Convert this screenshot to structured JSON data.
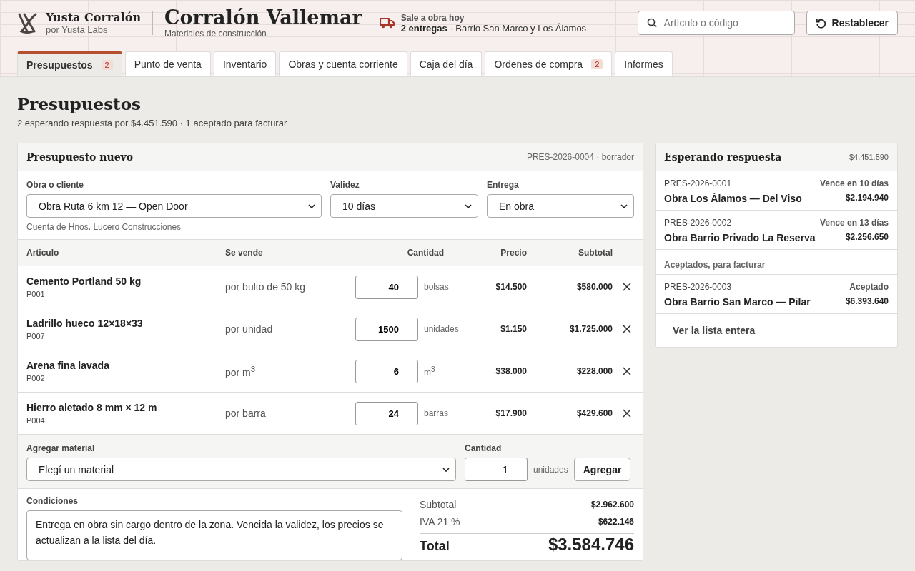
{
  "brand": {
    "name": "Yusta Corralón",
    "byline": "por Yusta Labs"
  },
  "store": {
    "name": "Corralón Vallemar",
    "subtitle": "Materiales de construcción"
  },
  "deliveries": {
    "label": "Sale a obra hoy",
    "count": "2 entregas",
    "places": "· Barrio San Marco y Los Álamos"
  },
  "search": {
    "placeholder": "Artículo o código"
  },
  "reset_button": "Restablecer",
  "tabs": [
    {
      "label": "Presupuestos",
      "badge": "2",
      "selected": true
    },
    {
      "label": "Punto de venta",
      "selected": false
    },
    {
      "label": "Inventario",
      "selected": false
    },
    {
      "label": "Obras y cuenta corriente",
      "selected": false
    },
    {
      "label": "Caja del día",
      "selected": false
    },
    {
      "label": "Órdenes de compra",
      "badge": "2",
      "selected": false
    },
    {
      "label": "Informes",
      "selected": false
    }
  ],
  "page": {
    "title": "Presupuestos",
    "summary": "2 esperando respuesta por $4.451.590 · 1 aceptado para facturar"
  },
  "quote": {
    "title": "Presupuesto nuevo",
    "code": "PRES-2026-0004 · borrador",
    "fields": [
      {
        "label": "Obra o cliente",
        "value": "Obra Ruta 6 km 12 — Open Door",
        "hint": "Cuenta de Hnos. Lucero Construcciones"
      },
      {
        "label": "Validez",
        "value": "10 días"
      },
      {
        "label": "Entrega",
        "value": "En obra"
      }
    ],
    "columns": [
      "Articulo",
      "Se vende",
      "Cantidad",
      "Precio",
      "Subtotal"
    ],
    "rows": [
      {
        "name": "Cemento Portland 50 kg",
        "code": "P001",
        "sold_by": "por bulto de 50 kg",
        "quantity": "40",
        "unit": "bolsas",
        "price": "$14.500",
        "subtotal": "$580.000"
      },
      {
        "name": "Ladrillo hueco 12×18×33",
        "code": "P007",
        "sold_by": "por unidad",
        "quantity": "1500",
        "unit": "unidades",
        "price": "$1.150",
        "subtotal": "$1.725.000"
      },
      {
        "name": "Arena fina lavada",
        "code": "P002",
        "sold_by": "por m$^{3}$",
        "quantity": "6",
        "unit": "m$^{3}$",
        "price": "$38.000",
        "subtotal": "$228.000"
      },
      {
        "name": "Hierro aletado 8 mm × 12 m",
        "code": "P004",
        "sold_by": "por barra",
        "quantity": "24",
        "unit": "barras",
        "price": "$17.900",
        "subtotal": "$429.600"
      }
    ],
    "add": {
      "material_label": "Agregar material",
      "material_value": "Elegí un material",
      "quantity_label": "Cantidad",
      "quantity": "1",
      "unit": "unidades",
      "button": "Agregar"
    },
    "conditions": {
      "label": "Condiciones",
      "text": "Entrega en obra sin cargo dentro de la zona. Vencida la validez, los precios se actualizan a la lista del día."
    },
    "totals": [
      {
        "label": "Subtotal",
        "value": "$2.962.600"
      },
      {
        "label": "IVA 21 %",
        "value": "$622.146"
      }
    ],
    "total": {
      "label": "Total",
      "value": "$3.584.746"
    }
  },
  "waiting": {
    "title": "Esperando respuesta",
    "amount": "$4.451.590",
    "items": [
      {
        "code": "PRES-2026-0001",
        "status": "Vence en 10 días",
        "name": "Obra Los Álamos — Del Viso",
        "amount": "$2.194.940"
      },
      {
        "code": "PRES-2026-0002",
        "status": "Vence en 13 días",
        "name": "Obra Barrio Privado La Reserva",
        "amount": "$2.256.650"
      }
    ],
    "accepted_heading": "Aceptados, para facturar",
    "accepted": [
      {
        "code": "PRES-2026-0003",
        "status": "Aceptado",
        "name": "Obra Barrio San Marco — Pilar",
        "amount": "$6.393.640"
      }
    ],
    "link": "Ver la lista entera"
  }
}
